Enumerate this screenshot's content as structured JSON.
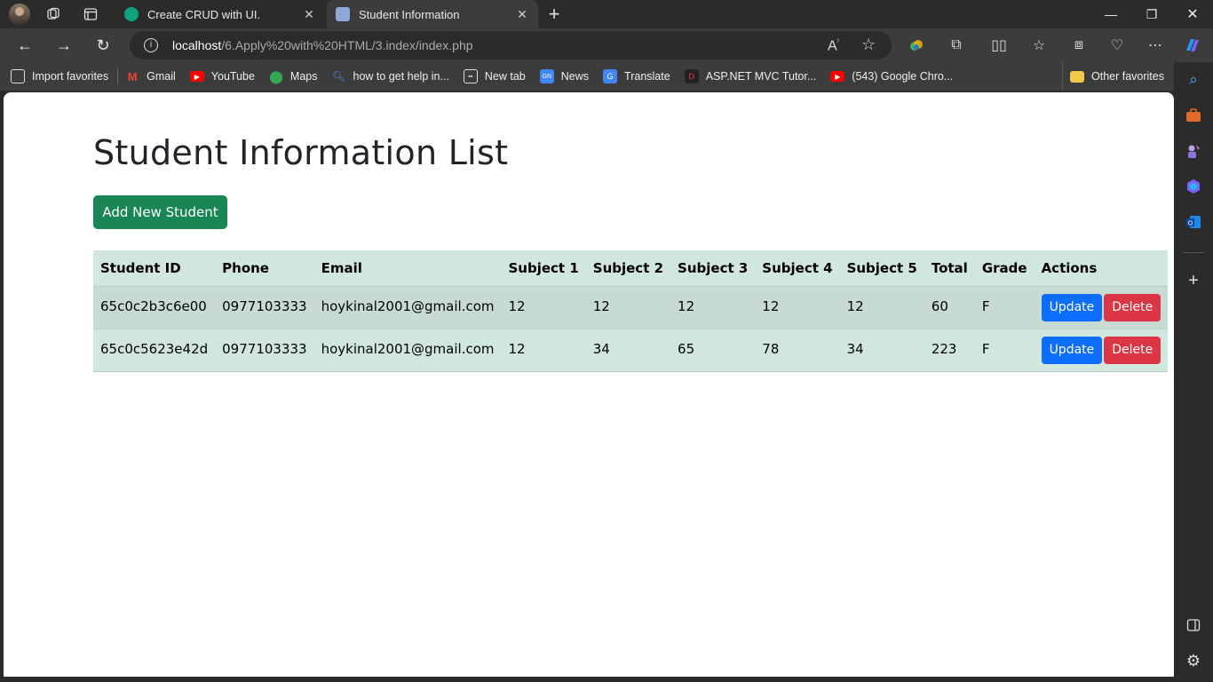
{
  "browser": {
    "tabs": [
      {
        "title": "Create CRUD with UI.",
        "favicon": "chatgpt-icon"
      },
      {
        "title": "Student Information",
        "favicon": "page-icon"
      }
    ],
    "address": {
      "host": "localhost",
      "path": "/6.Apply%20with%20HTML/3.index/index.php"
    },
    "favorites": [
      {
        "label": "Import favorites",
        "icon": "import-icon"
      },
      {
        "label": "Gmail",
        "icon": "gmail-icon"
      },
      {
        "label": "YouTube",
        "icon": "youtube-icon"
      },
      {
        "label": "Maps",
        "icon": "maps-icon"
      },
      {
        "label": "how to get help in...",
        "icon": "search-icon"
      },
      {
        "label": "New tab",
        "icon": "newtab-icon"
      },
      {
        "label": "News",
        "icon": "news-icon"
      },
      {
        "label": "Translate",
        "icon": "translate-icon"
      },
      {
        "label": "ASP.NET MVC Tutor...",
        "icon": "aspnet-icon"
      },
      {
        "label": "(543) Google Chro...",
        "icon": "youtube-icon"
      }
    ],
    "other_favorites": "Other favorites"
  },
  "page": {
    "title": "Student Information List",
    "add_button": "Add New Student",
    "columns": [
      "Student ID",
      "Phone",
      "Email",
      "Subject 1",
      "Subject 2",
      "Subject 3",
      "Subject 4",
      "Subject 5",
      "Total",
      "Grade",
      "Actions"
    ],
    "rows": [
      {
        "id": "65c0c2b3c6e00",
        "phone": "0977103333",
        "email": "hoykinal2001@gmail.com",
        "s1": "12",
        "s2": "12",
        "s3": "12",
        "s4": "12",
        "s5": "12",
        "total": "60",
        "grade": "F"
      },
      {
        "id": "65c0c5623e42d",
        "phone": "0977103333",
        "email": "hoykinal2001@gmail.com",
        "s1": "12",
        "s2": "34",
        "s3": "65",
        "s4": "78",
        "s5": "34",
        "total": "223",
        "grade": "F"
      }
    ],
    "update_label": "Update",
    "delete_label": "Delete"
  },
  "colors": {
    "success": "#198754",
    "primary": "#0d6efd",
    "danger": "#dc3545",
    "table_bg": "#d1e7dd"
  }
}
